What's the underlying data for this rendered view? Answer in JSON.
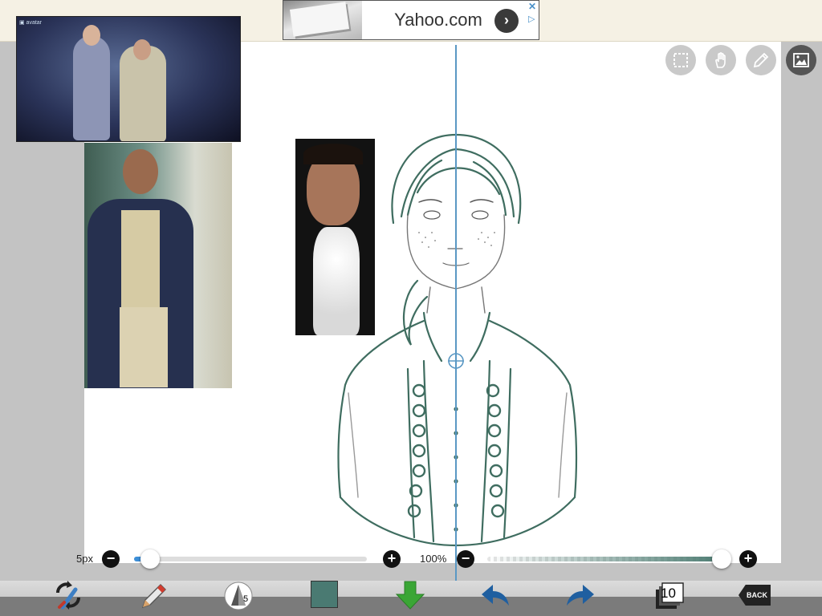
{
  "ad": {
    "text": "Yahoo.com",
    "go_icon": "chevron-right-icon",
    "close_icon": "close-icon",
    "choices_icon": "adchoices-icon"
  },
  "canvas": {
    "background": "#ffffff",
    "stage_photo_tag": "▣ avatar"
  },
  "top_tools": [
    {
      "name": "selection-tool",
      "icon": "dashed-square-icon"
    },
    {
      "name": "hand-tool",
      "icon": "hand-icon"
    },
    {
      "name": "ruler-tool",
      "icon": "ruler-pencil-icon"
    },
    {
      "name": "image-tool",
      "icon": "image-icon"
    }
  ],
  "brush_size": {
    "label": "5px",
    "minus": "−",
    "plus": "+",
    "value_fraction": 0.04
  },
  "opacity": {
    "label": "100%",
    "minus": "−",
    "plus": "+",
    "value_fraction": 1.0,
    "color": "#4a7a70"
  },
  "toolbar": {
    "brush_variant": "5",
    "current_color": "#4a7a72",
    "layer_count": "10",
    "back_label": "BACK",
    "accent_green": "#3aa635",
    "accent_blue": "#1f5fa0"
  }
}
